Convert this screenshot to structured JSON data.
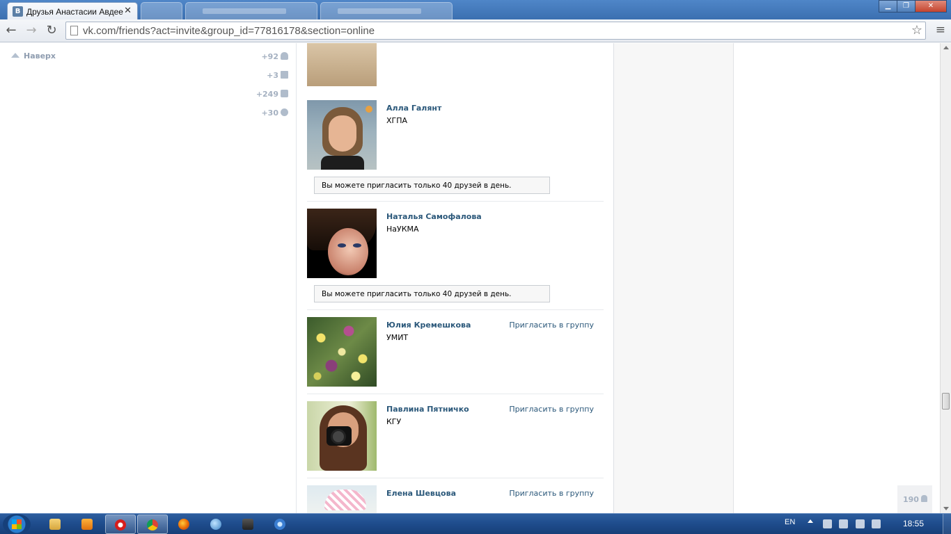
{
  "browser": {
    "tab_title": "Друзья Анастасии Авдее",
    "tab_favicon": "В",
    "url": "vk.com/friends?act=invite&group_id=77816178&section=online"
  },
  "sidebar": {
    "to_top": "Наверх",
    "counters": [
      {
        "value": "+92",
        "icon": "user-icon"
      },
      {
        "value": "+3",
        "icon": "mail-icon"
      },
      {
        "value": "+249",
        "icon": "chat-icon"
      },
      {
        "value": "+30",
        "icon": "gear-icon"
      }
    ]
  },
  "friends": [
    {
      "name": "",
      "sub": "",
      "invite": "",
      "notice": ""
    },
    {
      "name": "Алла Галянт",
      "sub": "ХГПА",
      "invite": "",
      "notice": "Вы можете пригласить только 40 друзей в день."
    },
    {
      "name": "Наталья Самофалова",
      "sub": "НаУКМА",
      "invite": "",
      "notice": "Вы можете пригласить только 40 друзей в день."
    },
    {
      "name": "Юлия Кремешкова",
      "sub": "УМИТ",
      "invite": "Пригласить в группу",
      "notice": ""
    },
    {
      "name": "Павлина Пятничко",
      "sub": "КГУ",
      "invite": "Пригласить в группу",
      "notice": ""
    },
    {
      "name": "Елена Шевцова",
      "sub": "",
      "invite": "Пригласить в группу",
      "notice": ""
    }
  ],
  "online_counter": "190",
  "taskbar": {
    "language": "EN",
    "clock": "18:55"
  },
  "colors": {
    "link": "#2b587a",
    "counter": "#a5b1c1",
    "taskbar": "#1e4c8c"
  }
}
